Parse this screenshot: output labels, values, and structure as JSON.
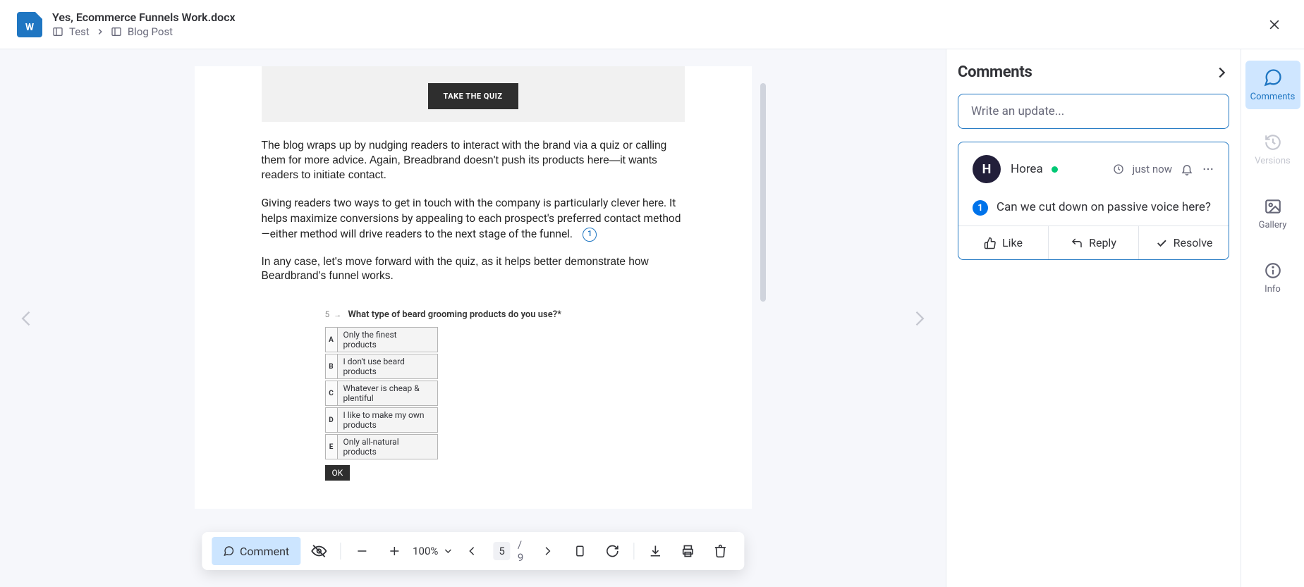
{
  "header": {
    "doc_icon_letter": "W",
    "file_name": "Yes, Ecommerce Funnels Work.docx",
    "breadcrumbs": [
      "Test",
      "Blog Post"
    ]
  },
  "document": {
    "promo_button": "TAKE THE QUIZ",
    "para1": "The blog wraps up by nudging readers to interact with the brand via a quiz or calling them for more advice. Again, Breadbrand doesn't push its products here—it wants readers to initiate contact.",
    "para2": "Giving readers two ways to get in touch with the company is particularly clever here. It helps maximize conversions by appealing to each prospect's preferred contact method—either method will drive readers to the next stage of the funnel.",
    "marker_number": "1",
    "para3": "In any case, let's move forward with the quiz, as it helps better demonstrate how Beardbrand's funnel works.",
    "quiz": {
      "number": "5",
      "question": "What type of beard grooming products do you use?*",
      "options": [
        {
          "key": "A",
          "text": "Only the finest products"
        },
        {
          "key": "B",
          "text": "I don't use beard products"
        },
        {
          "key": "C",
          "text": "Whatever is cheap & plentiful"
        },
        {
          "key": "D",
          "text": "I like to make my own products"
        },
        {
          "key": "E",
          "text": "Only all-natural products"
        }
      ],
      "ok_label": "OK"
    }
  },
  "toolbar": {
    "comment_label": "Comment",
    "zoom": "100%",
    "current_page": "5",
    "total_pages": "/ 9"
  },
  "comments_panel": {
    "title": "Comments",
    "input_placeholder": "Write an update...",
    "comment": {
      "avatar_letter": "H",
      "author": "Horea",
      "time": "just now",
      "badge": "1",
      "text": "Can we cut down on passive voice here?",
      "like_label": "Like",
      "reply_label": "Reply",
      "resolve_label": "Resolve"
    }
  },
  "sidebar": {
    "comments": "Comments",
    "versions": "Versions",
    "gallery": "Gallery",
    "info": "Info"
  }
}
